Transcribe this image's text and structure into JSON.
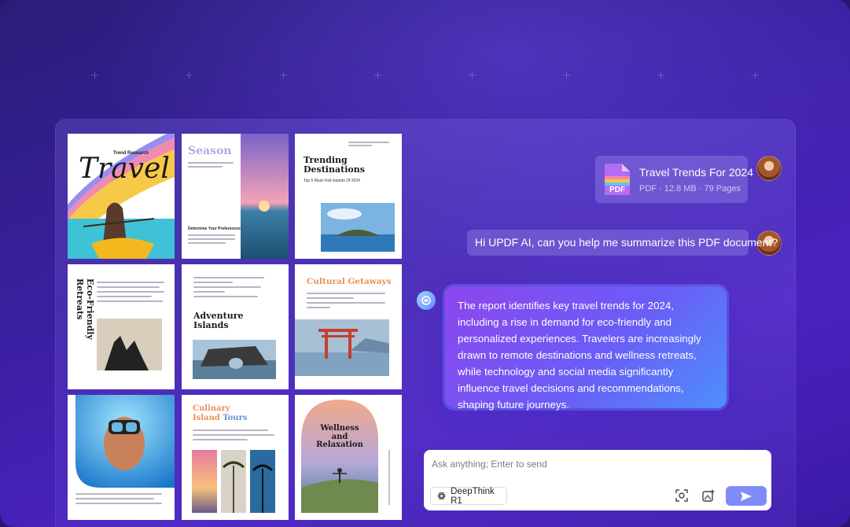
{
  "thumbnails": {
    "travel": {
      "title": "Travel",
      "subtitle": "Trend Research"
    },
    "season": {
      "title": "Season",
      "section": "Determine Your Preferences"
    },
    "trending": {
      "title_line1": "Trending",
      "title_line2": "Destinations",
      "subtitle": "Top 5 Must-Visit Islands Of 2024"
    },
    "eco": {
      "title": "Eco-Friendly Retreats"
    },
    "adventure": {
      "title_line1": "Adventure",
      "title_line2": "Islands"
    },
    "cultural": {
      "title": "Cultural Getaways"
    },
    "culinary": {
      "title_line1": "Culinary",
      "title_line2_a": "Island ",
      "title_line2_b": "Tours"
    },
    "wellness": {
      "title_line1": "Wellness and",
      "title_line2": "Relaxation"
    }
  },
  "chat": {
    "file": {
      "name": "Travel Trends For 2024",
      "meta": "PDF · 12.8 MB · 79 Pages",
      "icon_label": "PDF"
    },
    "user_message": "Hi UPDF AI, can you help me summarize this PDF document?",
    "ai_response": "The report identifies key travel trends for 2024, including a rise in demand for eco-friendly and personalized experiences. Travelers are increasingly drawn to remote destinations and wellness retreats, while technology and social media significantly influence travel decisions and recommendations, shaping future journeys."
  },
  "input": {
    "placeholder": "Ask anything; Enter to send",
    "deepthink_label": "DeepThink R1"
  },
  "colors": {
    "accent": "#7f8cf8",
    "ai_gradient_start": "#8d46ee",
    "ai_gradient_end": "#4d8ffb"
  }
}
